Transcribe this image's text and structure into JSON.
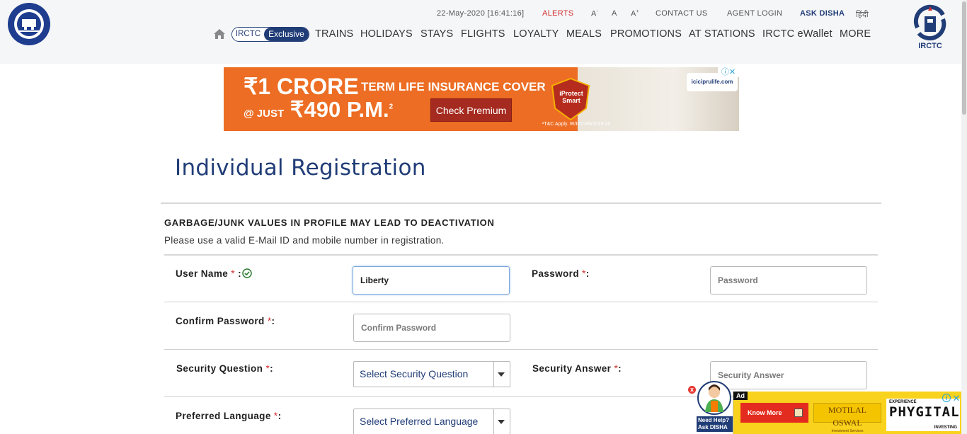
{
  "header": {
    "datetime": "22-May-2020 [16:41:16]",
    "alerts": "ALERTS",
    "font_small": "A",
    "font_small_sign": "-",
    "font_medium": "A",
    "font_large": "A",
    "font_large_sign": "+",
    "contact_us": "CONTACT US",
    "agent_login": "AGENT LOGIN",
    "ask_disha": "ASK DISHA",
    "hindi": "हिंदी",
    "logo_text": "IRCTC"
  },
  "nav": {
    "exclusive_part1": "IRCTC",
    "exclusive_part2": "Exclusive",
    "items": [
      "TRAINS",
      "HOLIDAYS",
      "STAYS",
      "FLIGHTS",
      "LOYALTY",
      "MEALS",
      "PROMOTIONS",
      "AT STATIONS",
      "IRCTC eWallet",
      "MORE"
    ]
  },
  "ad": {
    "big_line": "₹1 CRORE",
    "sub_line": "TERM LIFE INSURANCE COVER",
    "price_prefix": "@ JUST",
    "price": "₹490 P.M.",
    "price_sup": "2",
    "cta": "Check Premium",
    "badge_text": "iProtect Smart",
    "tnc": "²T&C Apply. W/II/1049/2019-20",
    "site": "iciciprulife.com"
  },
  "registration": {
    "title": "Individual Registration",
    "warning_title": "GARBAGE/JUNK VALUES IN PROFILE MAY LEAD TO DEACTIVATION",
    "warning_text": "Please use a valid E-Mail ID and mobile number in registration.",
    "required_marker": "*",
    "user_name_label": "User Name",
    "user_name_value": "Liberty",
    "password_label": "Password",
    "password_placeholder": "Password",
    "confirm_password_label": "Confirm Password",
    "confirm_password_placeholder": "Confirm Password",
    "security_question_label": "Security Question",
    "security_question_value": "Select Security Question",
    "security_answer_label": "Security Answer",
    "security_answer_placeholder": "Security Answer",
    "preferred_language_label": "Preferred Language",
    "preferred_language_value": "Select Preferred Language",
    "colon": ":"
  },
  "disha": {
    "help_line1": "Need Help?",
    "help_line2": "Ask DISHA",
    "close": "x"
  },
  "mini_ad": {
    "ad_tag": "Ad",
    "know_more": "Know More",
    "brand": "MOTILAL OSWAL",
    "brand_sub": "Investment Services",
    "exp": "EXPERIENCE",
    "word": "PHYGITAL",
    "investing": "INVESTING",
    "info": "i",
    "close": "✕"
  },
  "colors": {
    "brand_blue": "#213d77",
    "alert_red": "#d32f2f",
    "ad_orange": "#ec6d23"
  }
}
